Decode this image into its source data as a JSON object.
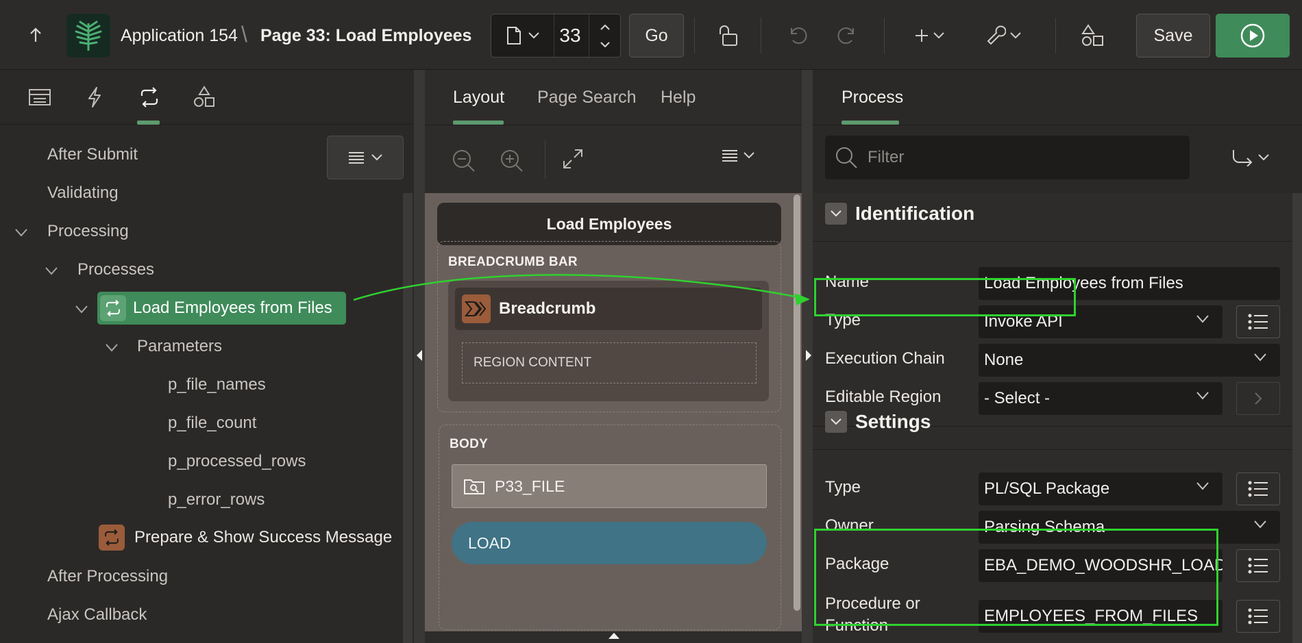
{
  "header": {
    "app_name": "Application 154",
    "separator": "\\",
    "page_title": "Page 33: Load Employees",
    "page_number": "33",
    "go_label": "Go",
    "save_label": "Save"
  },
  "left_panel": {
    "tabs": [
      "rendering-tab",
      "dynamic-actions-tab",
      "processing-tab",
      "shared-components-tab"
    ],
    "active_tab": "processing-tab",
    "tree": {
      "after_submit": "After Submit",
      "validating": "Validating",
      "processing": "Processing",
      "processes": "Processes",
      "selected_process": "Load Employees from Files",
      "parameters": "Parameters",
      "params": [
        "p_file_names",
        "p_file_count",
        "p_processed_rows",
        "p_error_rows"
      ],
      "second_process": "Prepare & Show Success Message",
      "after_processing": "After Processing",
      "ajax_callback": "Ajax Callback"
    }
  },
  "middle_panel": {
    "tabs": {
      "layout": "Layout",
      "page_search": "Page Search",
      "help": "Help"
    },
    "page_name": "Load Employees",
    "breadcrumb_bar_label": "BREADCRUMB BAR",
    "breadcrumb_region": "Breadcrumb",
    "region_content": "REGION CONTENT",
    "body_label": "BODY",
    "file_item": "P33_FILE",
    "load_button": "LOAD"
  },
  "right_panel": {
    "tab": "Process",
    "filter_placeholder": "Filter",
    "identification": {
      "title": "Identification",
      "name_label": "Name",
      "name_value": "Load Employees from Files",
      "type_label": "Type",
      "type_value": "Invoke API",
      "chain_label": "Execution Chain",
      "chain_value": "None",
      "editable_label": "Editable Region",
      "editable_value": "- Select -"
    },
    "settings": {
      "title": "Settings",
      "type_label": "Type",
      "type_value": "PL/SQL Package",
      "owner_label": "Owner",
      "owner_value": "Parsing Schema",
      "package_label": "Package",
      "package_value": "EBA_DEMO_WOODSHR_LOAD",
      "proc_label": "Procedure or Function",
      "proc_value": "EMPLOYEES_FROM_FILES"
    }
  },
  "colors": {
    "accent_green": "#3f8b5a",
    "highlight_green": "#2fd12f",
    "load_button": "#3f7385",
    "breadcrumb_icon": "#9a5c3a"
  }
}
